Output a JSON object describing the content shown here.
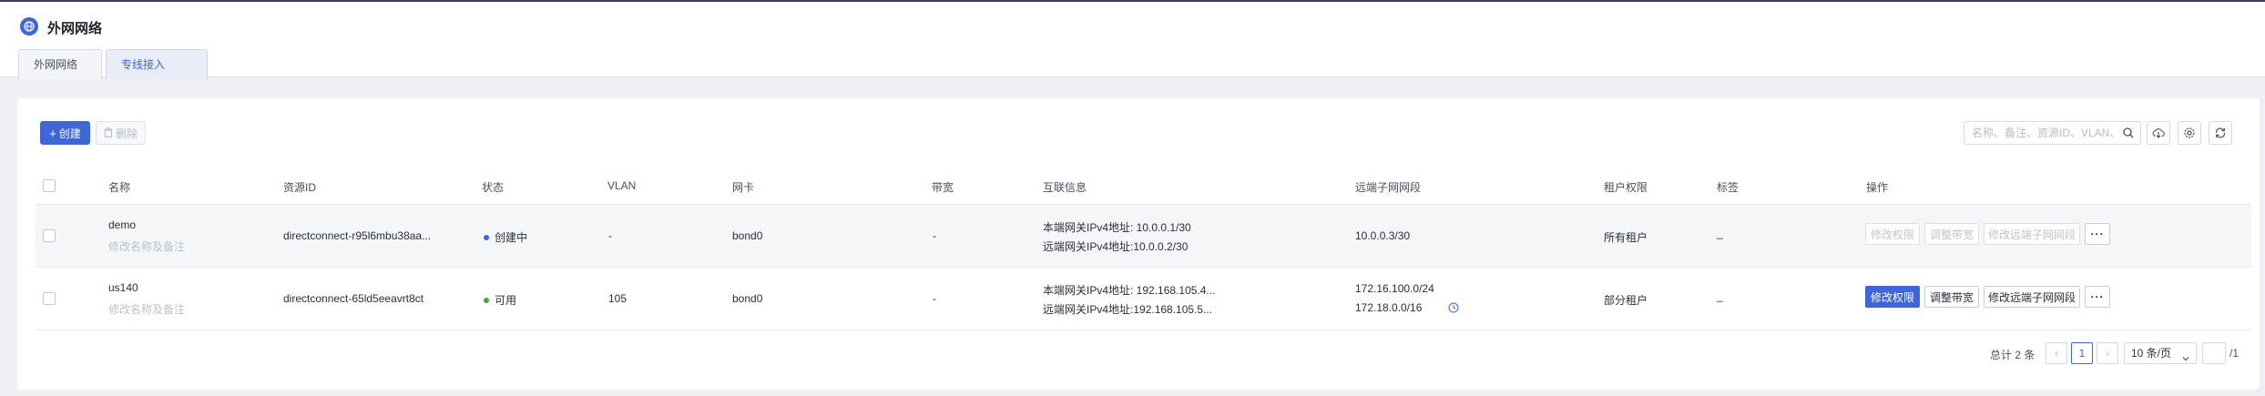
{
  "app": {
    "title": "外网网络",
    "logo_icon": "globe-icon"
  },
  "tabs": [
    {
      "label": "外网网络",
      "active": false
    },
    {
      "label": "专线接入",
      "active": true
    }
  ],
  "toolbar": {
    "create_label": "创建",
    "delete_label": "删除",
    "search_placeholder": "名称、备注、资源ID、VLAN、",
    "icons": [
      "search-icon",
      "cloud-download-icon",
      "settings-icon",
      "refresh-icon"
    ]
  },
  "table": {
    "columns": [
      "名称",
      "资源ID",
      "状态",
      "VLAN",
      "网卡",
      "带宽",
      "互联信息",
      "远端子网网段",
      "租户权限",
      "标签",
      "操作"
    ],
    "rows": [
      {
        "name": "demo",
        "remark": "修改名称及备注",
        "resource_id": "directconnect-r95l6mbu38aa...",
        "status": "创建中",
        "status_color": "#3f66d8",
        "vlan": "-",
        "nic": "bond0",
        "bandwidth": "-",
        "interconnect_local": "本端网关IPv4地址: 10.0.0.1/30",
        "interconnect_remote": "远端网关IPv4地址:10.0.0.2/30",
        "remote_subnets": [
          "10.0.0.3/30"
        ],
        "tenant": "所有租户",
        "tag": "_",
        "actions": {
          "modify_permission": "修改权限",
          "adjust_bandwidth": "调整带宽",
          "modify_subnet": "修改远端子网网段",
          "more": "···",
          "enabled": false
        }
      },
      {
        "name": "us140",
        "remark": "修改名称及备注",
        "resource_id": "directconnect-65ld5eeavrt8ct",
        "status": "可用",
        "status_color": "#3aa845",
        "vlan": "105",
        "nic": "bond0",
        "bandwidth": "-",
        "interconnect_local": "本端网关IPv4地址: 192.168.105.4...",
        "interconnect_remote": "远端网关IPv4地址:192.168.105.5...",
        "remote_subnets": [
          "172.16.100.0/24",
          "172.18.0.0/16"
        ],
        "tenant": "部分租户",
        "tag": "_",
        "actions": {
          "modify_permission": "修改权限",
          "adjust_bandwidth": "调整带宽",
          "modify_subnet": "修改远端子网网段",
          "more": "···",
          "enabled": true
        }
      }
    ]
  },
  "pagination": {
    "total_label": "总计 2 条",
    "current_page": "1",
    "page_size_label": "10 条/页",
    "pages_label": "/1"
  },
  "colors": {
    "primary": "#3f66d8",
    "available": "#3aa845"
  }
}
